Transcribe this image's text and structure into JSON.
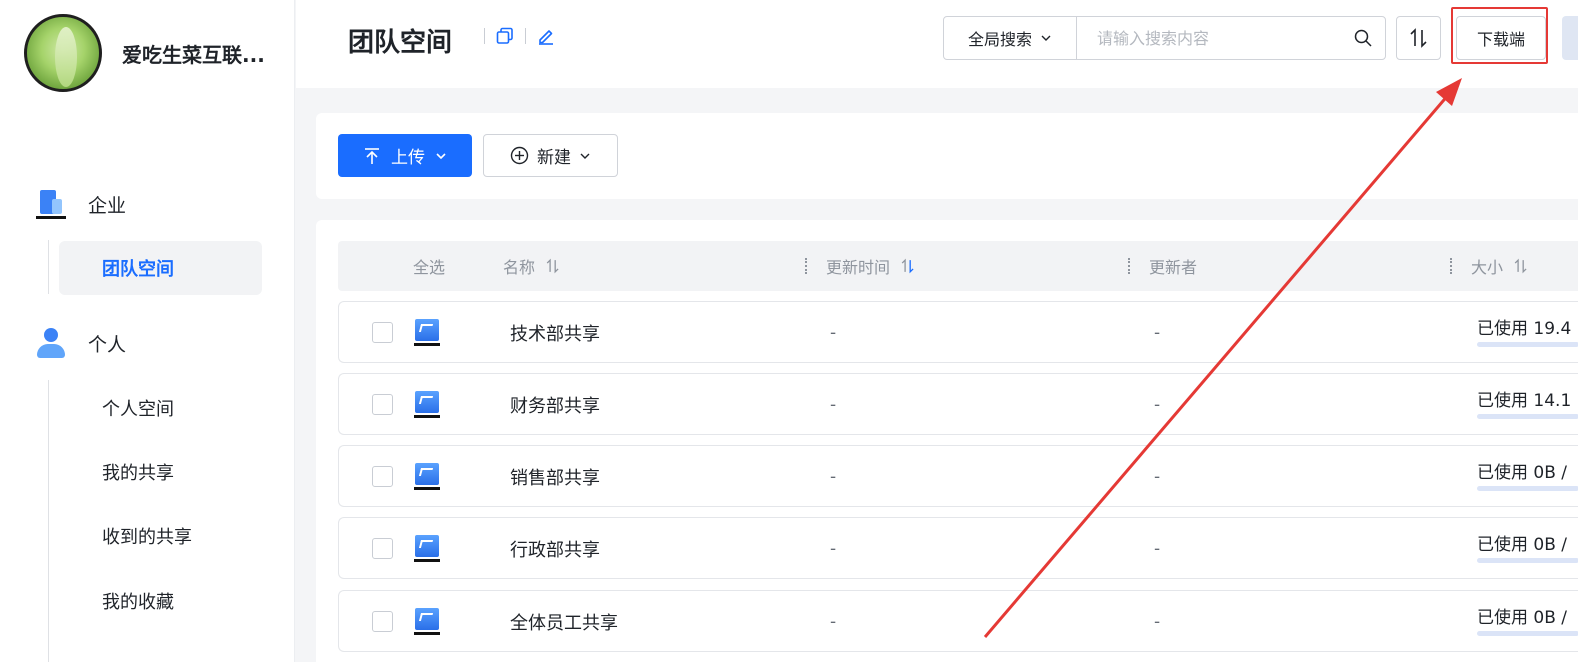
{
  "sidebar": {
    "brand_name": "爱吃生菜互联...",
    "sections": [
      {
        "label": "企业",
        "icon": "building-icon"
      },
      {
        "label": "个人",
        "icon": "person-icon"
      }
    ],
    "enterprise_items": [
      {
        "label": "团队空间",
        "active": true
      }
    ],
    "personal_items": [
      {
        "label": "个人空间"
      },
      {
        "label": "我的共享"
      },
      {
        "label": "收到的共享"
      },
      {
        "label": "我的收藏"
      }
    ]
  },
  "header": {
    "title": "团队空间",
    "search_scope": "全局搜索",
    "search_placeholder": "请输入搜索内容",
    "download_label": "下载端"
  },
  "toolbar": {
    "upload_label": "上传",
    "new_label": "新建"
  },
  "table": {
    "columns": {
      "select_all": "全选",
      "name": "名称",
      "updated_time": "更新时间",
      "updater": "更新者",
      "size": "大小"
    },
    "rows": [
      {
        "name": "技术部共享",
        "updated_time": "-",
        "updater": "-",
        "usage": "已使用 19.4"
      },
      {
        "name": "财务部共享",
        "updated_time": "-",
        "updater": "-",
        "usage": "已使用 14.1"
      },
      {
        "name": "销售部共享",
        "updated_time": "-",
        "updater": "-",
        "usage": "已使用 0B /"
      },
      {
        "name": "行政部共享",
        "updated_time": "-",
        "updater": "-",
        "usage": "已使用 0B /"
      },
      {
        "name": "全体员工共享",
        "updated_time": "-",
        "updater": "-",
        "usage": "已使用 0B /"
      }
    ]
  },
  "colors": {
    "accent": "#1a6dff",
    "highlight": "#e53935"
  }
}
